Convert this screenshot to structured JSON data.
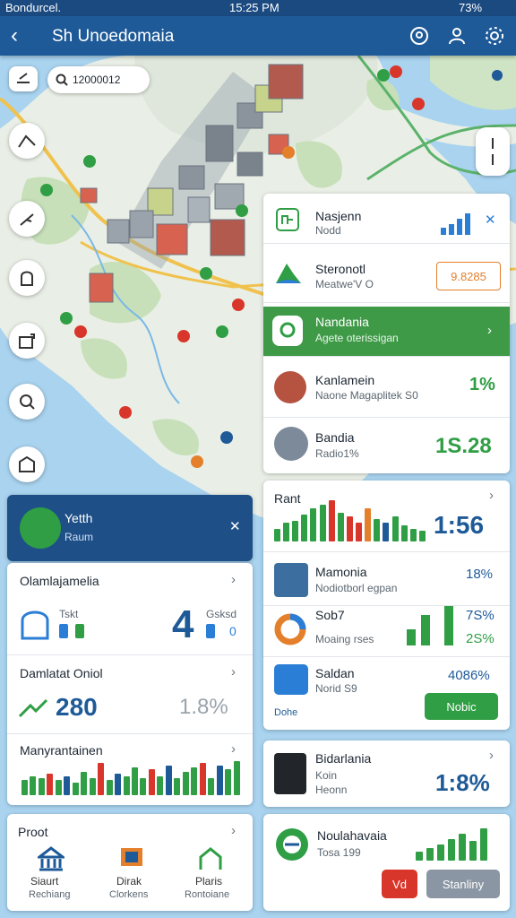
{
  "status_bar": {
    "carrier": "Bondurcel.",
    "time": "15:25 PM",
    "battery": "73%"
  },
  "app_bar": {
    "title": "Sh Unoedomaia",
    "back_icon": "back-arrow-icon",
    "icons": [
      "location-pin-icon",
      "person-icon",
      "settings-icon"
    ]
  },
  "search": {
    "value": "12000012"
  },
  "map_controls": [
    "route-icon",
    "hiking-icon",
    "marker-icon",
    "layers-icon",
    "search-location-icon",
    "building-icon"
  ],
  "panel_right": {
    "items": [
      {
        "title": "Nasjenn",
        "sub": "Nodd",
        "icon": "network-icon"
      },
      {
        "title": "Steronotl",
        "sub": "Meatwe'V O",
        "badge": "9.8285"
      },
      {
        "title": "Nandania",
        "sub": "Agete oterissigan",
        "highlight": true
      },
      {
        "title": "Kanlamein",
        "sub": "Naone Magaplitek S0",
        "value": "1%"
      },
      {
        "title": "Bandia",
        "sub": "Radio1%",
        "value": "1S.28"
      }
    ]
  },
  "profile_card": {
    "name": "Yetth",
    "sub": "Raum"
  },
  "left_cards": [
    {
      "title": "Olamlajamelia",
      "label": "Tskt",
      "value": "4",
      "label2": "Gsksd",
      "value2": "0"
    },
    {
      "title": "Damlatat Oniol",
      "value": "280",
      "value2": "1.8%"
    },
    {
      "title": "Manyrantainen",
      "chart": [
        14,
        18,
        16,
        20,
        14,
        18,
        12,
        22,
        16,
        30,
        14,
        20,
        18,
        26,
        16,
        24,
        18,
        28,
        16,
        22,
        26,
        30,
        16,
        28,
        24,
        32
      ]
    },
    {
      "title": "Proot",
      "actions": [
        {
          "label": "Siaurt",
          "label2": "Rechiang",
          "icon": "bank-icon"
        },
        {
          "label": "Dirak",
          "label2": "Clorkens",
          "icon": "monitor-icon"
        },
        {
          "label": "Plaris",
          "label2": "Rontoiane",
          "icon": "home-icon"
        }
      ]
    }
  ],
  "right_cards": [
    {
      "title": "Rant",
      "value": "1:56",
      "chart": [
        12,
        18,
        20,
        26,
        32,
        36,
        40,
        28,
        24,
        18,
        32,
        22,
        18,
        24,
        16,
        12,
        10
      ]
    },
    {
      "title": "Mamonia",
      "sub": "Nodiotborl egpan",
      "value": "18%"
    },
    {
      "title": "Sob7",
      "value": "7S%",
      "value2": "2S%",
      "sub": "Moaing rses"
    },
    {
      "title": "Saldan",
      "sub": "Norid S9",
      "value": "4086%",
      "sub2": "Dohe",
      "button": "Nobic"
    },
    {
      "title": "Bidarlania",
      "sub": "Koin",
      "sub2": "Heonn",
      "value": "1:8%"
    },
    {
      "title": "Noulahavaia",
      "sub": "Tosa 199",
      "btn1": "Vd",
      "btn2": "Stanliny"
    }
  ],
  "colors": {
    "primary": "#1e5a98",
    "green": "#2f9e44",
    "red": "#d9362b",
    "orange": "#e4802b"
  }
}
